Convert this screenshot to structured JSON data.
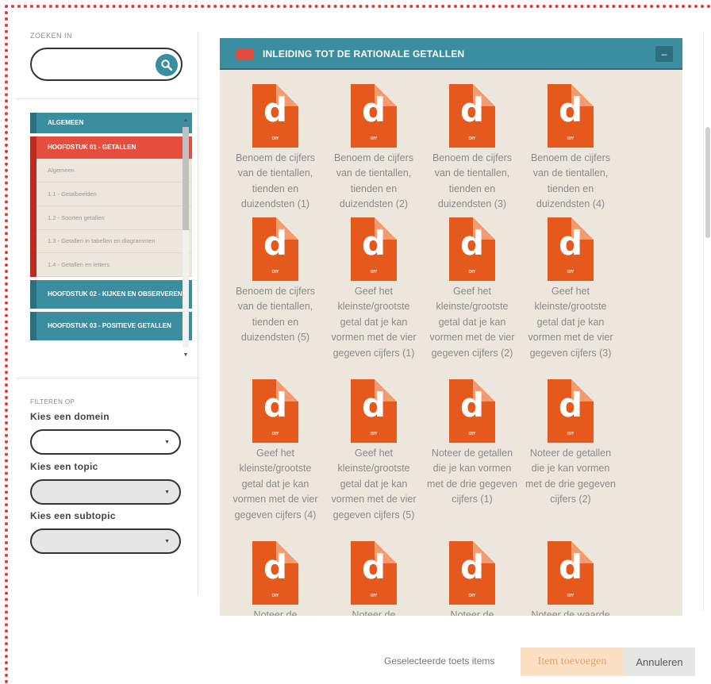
{
  "search": {
    "label": "ZOEKEN IN",
    "value": ""
  },
  "tree": {
    "items": [
      {
        "label": "ALGEMEEN"
      },
      {
        "label": "HOOFDSTUK 01 - GETALLEN"
      },
      {
        "label": "HOOFDSTUK 02 - KIJKEN EN OBSERVEREN"
      },
      {
        "label": "HOOFDSTUK 03 - POSITIEVE GETALLEN"
      }
    ],
    "subitems": [
      {
        "label": "Algemeen"
      },
      {
        "label": "1.1 - Getalbeelden"
      },
      {
        "label": "1.2 - Soorten getallen"
      },
      {
        "label": "1.3 - Getallen in tabellen en diagrammen"
      },
      {
        "label": "1.4 - Getallen en letters"
      }
    ]
  },
  "filters": {
    "heading": "FILTEREN OP",
    "domain_label": "Kies een domein",
    "topic_label": "Kies een topic",
    "subtopic_label": "Kies een subtopic",
    "domain_value": "",
    "topic_value": "",
    "subtopic_value": ""
  },
  "panel": {
    "title": "INLEIDING TOT DE RATIONALE GETALLEN",
    "collapse_label": "–"
  },
  "icons": {
    "doc_letter": "d",
    "doc_ext": "DIY"
  },
  "tiles": [
    {
      "label": "Benoem de cijfers van de tientallen, tienden en duizendsten (1)"
    },
    {
      "label": "Benoem de cijfers van de tientallen, tienden en duizendsten (2)"
    },
    {
      "label": "Benoem de cijfers van de tientallen, tienden en duizendsten (3)"
    },
    {
      "label": "Benoem de cijfers van de tientallen, tienden en duizendsten (4)"
    },
    {
      "label": "Benoem de cijfers van de tientallen, tienden en duizendsten (5)"
    },
    {
      "label": "Geef het kleinste/grootste getal dat je kan vormen met de vier gegeven cijfers (1)"
    },
    {
      "label": "Geef het kleinste/grootste getal dat je kan vormen met de vier gegeven cijfers (2)"
    },
    {
      "label": "Geef het kleinste/grootste getal dat je kan vormen met de vier gegeven cijfers (3)"
    },
    {
      "label": "Geef het kleinste/grootste getal dat je kan vormen met de vier gegeven cijfers (4)"
    },
    {
      "label": "Geef het kleinste/grootste getal dat je kan vormen met de vier gegeven cijfers (5)"
    },
    {
      "label": "Noteer de getallen die je kan vormen met de drie gegeven cijfers (1)"
    },
    {
      "label": "Noteer de getallen die je kan vormen met de drie gegeven cijfers (2)"
    },
    {
      "label": "Noteer de"
    },
    {
      "label": "Noteer de"
    },
    {
      "label": "Noteer de"
    },
    {
      "label": "Noteer de waarde"
    }
  ],
  "footer": {
    "selected_label": "Geselecteerde toets items",
    "add_button": "Item toevoegen",
    "cancel_button": "Annuleren"
  },
  "colors": {
    "accent_teal": "#3a8ea0",
    "accent_red": "#e64d3d",
    "doc_orange": "#e55a1c",
    "panel_bg": "#ece6dc"
  }
}
